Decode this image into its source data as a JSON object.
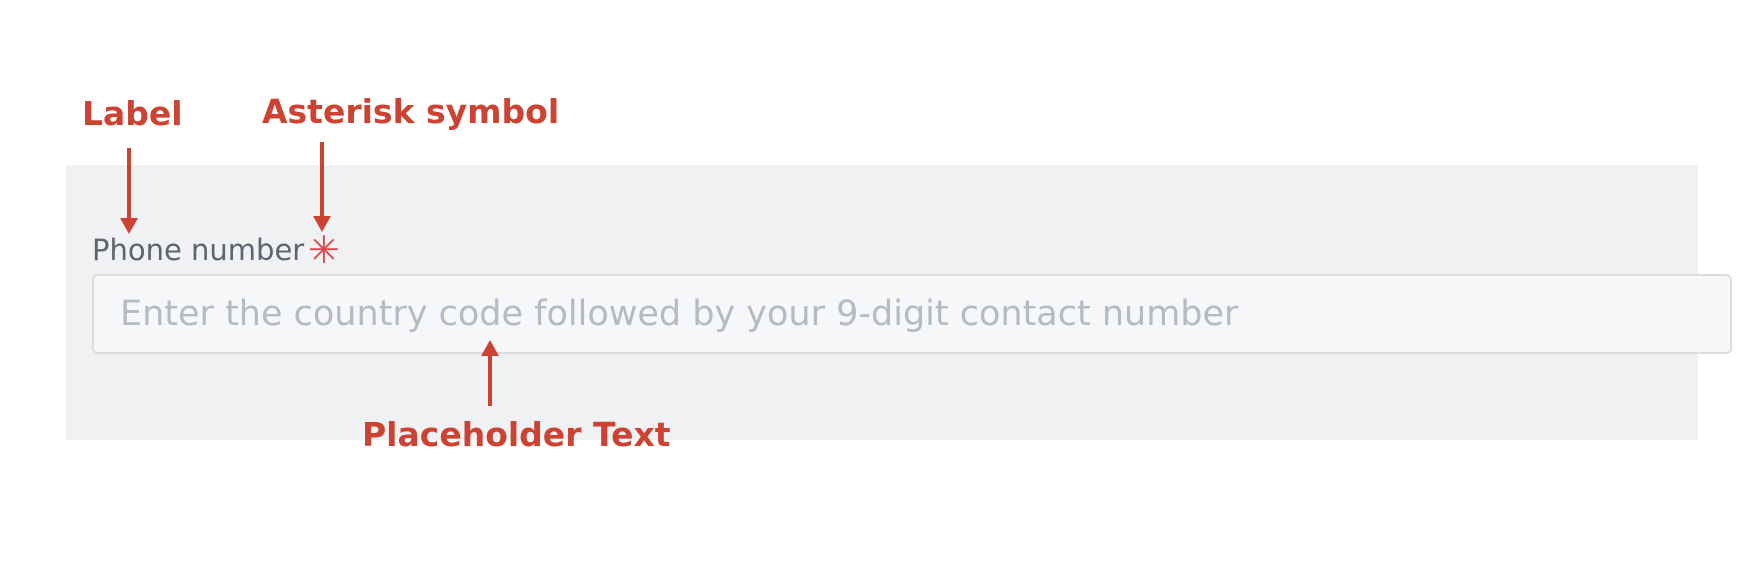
{
  "form": {
    "field_label": "Phone number",
    "required_marker": "✳",
    "input_placeholder": "Enter the country code followed by your 9-digit contact number",
    "input_value": ""
  },
  "annotations": {
    "label": "Label",
    "asterisk": "Asterisk symbol",
    "placeholder": "Placeholder Text"
  },
  "colors": {
    "annotation": "#cc4333",
    "asterisk": "#e0454a",
    "panel_background": "#f0f1f3",
    "input_background": "#f6f7f9",
    "placeholder_text": "#b6bac1",
    "label_text": "#5f6470"
  }
}
